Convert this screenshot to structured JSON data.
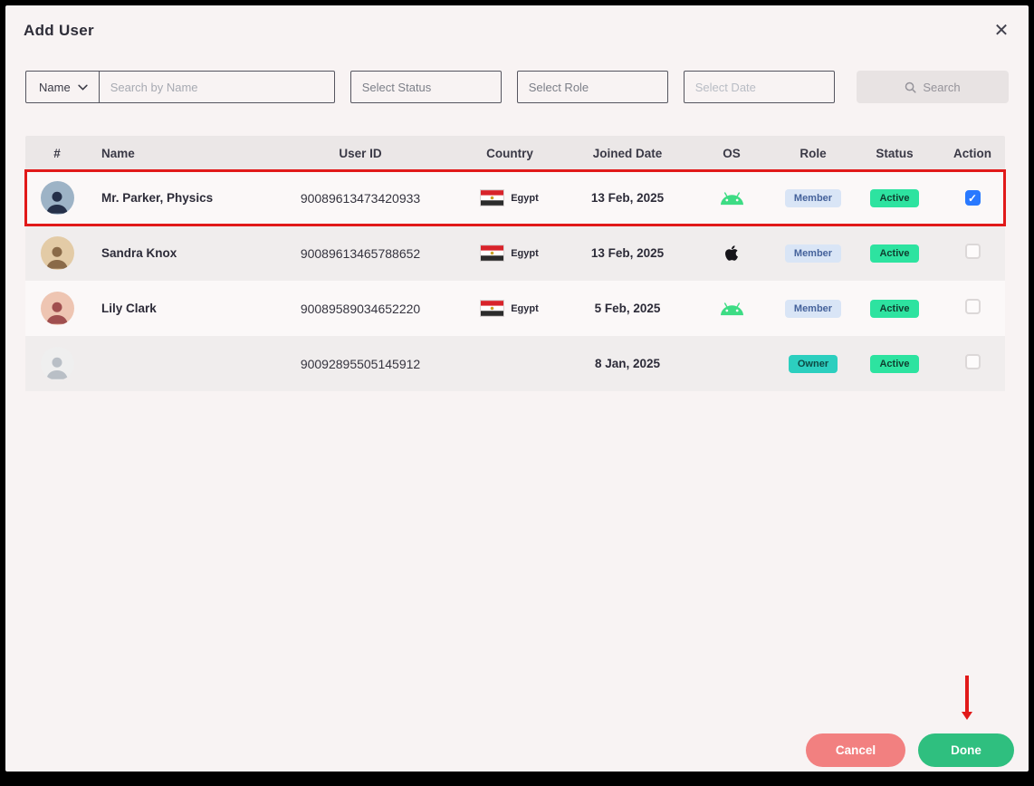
{
  "window": {
    "title": "Add User",
    "close_icon": "✕"
  },
  "filters": {
    "field_dropdown": {
      "value": "Name"
    },
    "name_search": {
      "placeholder": "Search by Name"
    },
    "status_select": {
      "label": "Select Status"
    },
    "role_select": {
      "label": "Select Role"
    },
    "date_select": {
      "placeholder": "Select Date"
    },
    "search_button": {
      "label": "Search"
    }
  },
  "table": {
    "headers": [
      "#",
      "Name",
      "User ID",
      "Country",
      "Joined Date",
      "OS",
      "Role",
      "Status",
      "Action"
    ],
    "rows": [
      {
        "name": "Mr. Parker, Physics",
        "user_id": "90089613473420933",
        "country": "Egypt",
        "joined_date": "13 Feb, 2025",
        "os": "android",
        "role": "Member",
        "status": "Active",
        "checked": true,
        "highlighted": true,
        "avatar": {
          "bg": "#9db3c6",
          "fg": "#253049"
        }
      },
      {
        "name": "Sandra Knox",
        "user_id": "90089613465788652",
        "country": "Egypt",
        "joined_date": "13 Feb, 2025",
        "os": "apple",
        "role": "Member",
        "status": "Active",
        "checked": false,
        "highlighted": false,
        "avatar": {
          "bg": "#e3cba6",
          "fg": "#8a6a48"
        }
      },
      {
        "name": "Lily Clark",
        "user_id": "90089589034652220",
        "country": "Egypt",
        "joined_date": "5 Feb, 2025",
        "os": "android",
        "role": "Member",
        "status": "Active",
        "checked": false,
        "highlighted": false,
        "avatar": {
          "bg": "#eec5b2",
          "fg": "#a04f4f"
        }
      },
      {
        "name": "",
        "user_id": "90092895505145912",
        "country": "",
        "joined_date": "8 Jan, 2025",
        "os": "",
        "role": "Owner",
        "status": "Active",
        "checked": false,
        "highlighted": false,
        "avatar": {
          "bg": "#efefef",
          "fg": "#b9bfc6"
        }
      }
    ]
  },
  "footer": {
    "cancel": "Cancel",
    "done": "Done"
  },
  "colors": {
    "modal_bg": "#f8f3f3",
    "table_header_bg": "#ebe7e7",
    "done_green": "#2fbf7f",
    "cancel_red": "#f28080",
    "checkbox_blue": "#2979ff",
    "annotation_red": "#e11919",
    "active_badge_green": "#2de3a0",
    "member_badge_bg": "#d9e5f6",
    "owner_badge_teal": "#2ccfbf",
    "android_green": "#3ddc84"
  },
  "annotations": {
    "highlighted_row_index": 0,
    "arrow_points_to": "done-button"
  }
}
